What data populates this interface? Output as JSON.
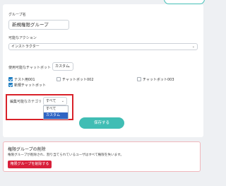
{
  "group": {
    "name_label": "グループ名",
    "name_value": "新規権限グループ"
  },
  "action": {
    "label": "可能なアクション",
    "selected": "インストラクター"
  },
  "chatbot_usage": {
    "label": "使用可能なチャットボット",
    "mode": "カスタム",
    "items": [
      {
        "label": "テスト用001",
        "checked": true
      },
      {
        "label": "チャットボット002",
        "checked": false
      },
      {
        "label": "チャットボット003",
        "checked": false
      },
      {
        "label": "新規チャットボット",
        "checked": true
      }
    ]
  },
  "category": {
    "label": "編集可能なカテゴリ",
    "selected": "すべて",
    "options": [
      "すべて",
      "カスタム"
    ],
    "highlighted_option": "カスタム"
  },
  "save_button": "保存する",
  "delete_section": {
    "title": "権限グループの削除",
    "description": "権限グループが削除され、割り当てられているユーザはすべて権限を失います。",
    "button": "権限グループを削除する"
  },
  "colors": {
    "accent": "#40bdb4",
    "danger": "#d81f3a",
    "highlight_border": "#d9222a",
    "checkbox": "#1f7ec3"
  }
}
